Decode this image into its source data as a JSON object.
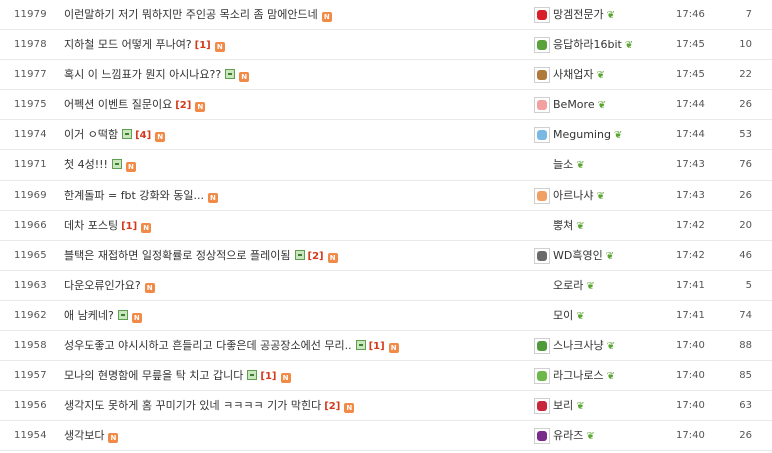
{
  "board": {
    "rows": [
      {
        "num": "11979",
        "title": "이런말하기 저기 뭐하지만 주인공 목소리 좀 맘에안드네",
        "img": false,
        "cmt": "",
        "new": true,
        "author": "망겜전문가",
        "avatar_color": "#d91f2a",
        "time": "17:46",
        "views": "7"
      },
      {
        "num": "11978",
        "title": "지하철 모드 어떻게 푸나여?",
        "img": false,
        "cmt": "[1]",
        "new": true,
        "author": "응답하라16bit",
        "avatar_color": "#5aa23b",
        "time": "17:45",
        "views": "10"
      },
      {
        "num": "11977",
        "title": "혹시 이 느낌표가 뭔지 아시나요??",
        "img": true,
        "cmt": "",
        "new": true,
        "author": "사채업자",
        "avatar_color": "#b07a3a",
        "time": "17:45",
        "views": "22"
      },
      {
        "num": "11975",
        "title": "어펙션 이벤트 질문이요",
        "img": false,
        "cmt": "[2]",
        "new": true,
        "author": "BeMore",
        "avatar_color": "#f2a0a0",
        "time": "17:44",
        "views": "26"
      },
      {
        "num": "11974",
        "title": "이거 ㅇ떡함",
        "img": true,
        "cmt": "[4]",
        "new": true,
        "author": "Meguming",
        "avatar_color": "#7cb8e4",
        "time": "17:44",
        "views": "53"
      },
      {
        "num": "11971",
        "title": "첫 4성!!!",
        "img": true,
        "cmt": "",
        "new": true,
        "author": "늘소",
        "avatar_color": "",
        "time": "17:43",
        "views": "76"
      },
      {
        "num": "11969",
        "title": "한계돌파 = fbt 강화와 동일...",
        "img": false,
        "cmt": "",
        "new": true,
        "author": "아르나샤",
        "avatar_color": "#f0a062",
        "time": "17:43",
        "views": "26"
      },
      {
        "num": "11966",
        "title": "데차 포스팅",
        "img": false,
        "cmt": "[1]",
        "new": true,
        "author": "뿡쳐",
        "avatar_color": "",
        "time": "17:42",
        "views": "20"
      },
      {
        "num": "11965",
        "title": "블택은 재접하면 일정확률로 정상적으로 플레이됨",
        "img": true,
        "cmt": "[2]",
        "new": true,
        "author": "WD흑영인",
        "avatar_color": "#6a6a6a",
        "time": "17:42",
        "views": "46"
      },
      {
        "num": "11963",
        "title": "다운오류인가요?",
        "img": false,
        "cmt": "",
        "new": true,
        "author": "오로라",
        "avatar_color": "",
        "time": "17:41",
        "views": "5"
      },
      {
        "num": "11962",
        "title": "애 남케네?",
        "img": true,
        "cmt": "",
        "new": true,
        "author": "모이",
        "avatar_color": "",
        "time": "17:41",
        "views": "74"
      },
      {
        "num": "11958",
        "title": "성우도좋고 야시시하고 흔들리고 다좋은데 공공장소에선 무리..",
        "img": true,
        "cmt": "[1]",
        "new": true,
        "author": "스나크사냥",
        "avatar_color": "#4f9a3a",
        "time": "17:40",
        "views": "88"
      },
      {
        "num": "11957",
        "title": "모나의 현명함에 무릎을 탁 치고 갑니다",
        "img": true,
        "cmt": "[1]",
        "new": true,
        "author": "라그나로스",
        "avatar_color": "#6cb84a",
        "time": "17:40",
        "views": "85"
      },
      {
        "num": "11956",
        "title": "생각지도 못하게 홈 꾸미기가 있네 ㅋㅋㅋㅋ 기가 막힌다",
        "img": false,
        "cmt": "[2]",
        "new": true,
        "author": "보리",
        "avatar_color": "#c8263a",
        "time": "17:40",
        "views": "63"
      },
      {
        "num": "11954",
        "title": "생각보다",
        "img": false,
        "cmt": "",
        "new": true,
        "author": "유라즈",
        "avatar_color": "#7a2a8a",
        "time": "17:40",
        "views": "26"
      }
    ],
    "icons": {
      "new_badge": "N",
      "image_attach": "image-attach-icon",
      "level": "❦"
    }
  }
}
